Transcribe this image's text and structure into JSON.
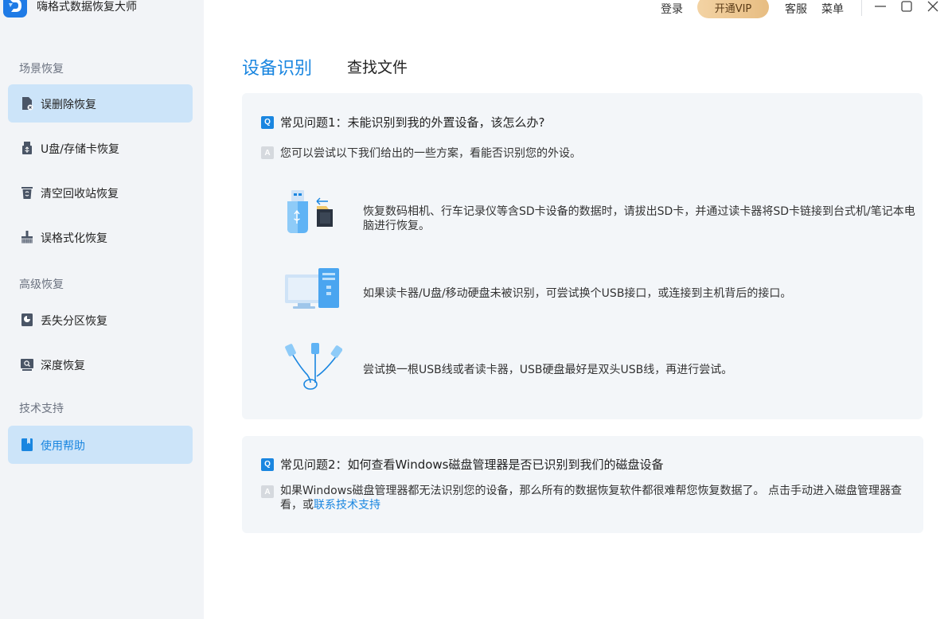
{
  "app": {
    "title": "嗨格式数据恢复大师"
  },
  "header": {
    "login": "登录",
    "vip": "开通VIP",
    "service": "客服",
    "menu": "菜单"
  },
  "sidebar": {
    "sections": [
      {
        "label": "场景恢复"
      },
      {
        "label": "高级恢复"
      },
      {
        "label": "技术支持"
      }
    ],
    "items": [
      {
        "label": "误删除恢复",
        "icon": "file-delete-icon"
      },
      {
        "label": "U盘/存储卡恢复",
        "icon": "usb-drive-icon"
      },
      {
        "label": "清空回收站恢复",
        "icon": "recycle-bin-icon"
      },
      {
        "label": "误格式化恢复",
        "icon": "format-icon"
      },
      {
        "label": "丢失分区恢复",
        "icon": "partition-icon"
      },
      {
        "label": "深度恢复",
        "icon": "deep-scan-icon"
      },
      {
        "label": "使用帮助",
        "icon": "help-book-icon"
      }
    ]
  },
  "main": {
    "tabs": [
      {
        "label": "设备识别",
        "active": true
      },
      {
        "label": "查找文件",
        "active": false
      }
    ],
    "faq1": {
      "q_badge": "Q",
      "question": "常见问题1：未能识别到我的外置设备，该怎么办?",
      "a_badge": "A",
      "answer": "您可以尝试以下我们给出的一些方案，看能否识别您的外设。",
      "tips": [
        {
          "text": "恢复数码相机、行车记录仪等含SD卡设备的数据时，请拔出SD卡，并通过读卡器将SD卡链接到台式机/笔记本电脑进行恢复。"
        },
        {
          "text": "如果读卡器/U盘/移动硬盘未被识别，可尝试换个USB接口，或连接到主机背后的接口。"
        },
        {
          "text": "尝试换一根USB线或者读卡器，USB硬盘最好是双头USB线，再进行尝试。"
        }
      ]
    },
    "faq2": {
      "q_badge": "Q",
      "question": "常见问题2：如何查看Windows磁盘管理器是否已识别到我们的磁盘设备",
      "a_badge": "A",
      "answer_prefix": "如果Windows磁盘管理器都无法识别您的设备，那么所有的数据恢复软件都很难帮您恢复数据了。 点击手动进入磁盘管理器查看，或",
      "answer_link": "联系技术支持"
    }
  },
  "colors": {
    "accent": "#1a86e0",
    "sidebar_bg": "#f2f4f7",
    "active_item_bg": "#cce4f9",
    "card_bg": "#f3f6f9",
    "vip_gold": "#e7bd82"
  }
}
